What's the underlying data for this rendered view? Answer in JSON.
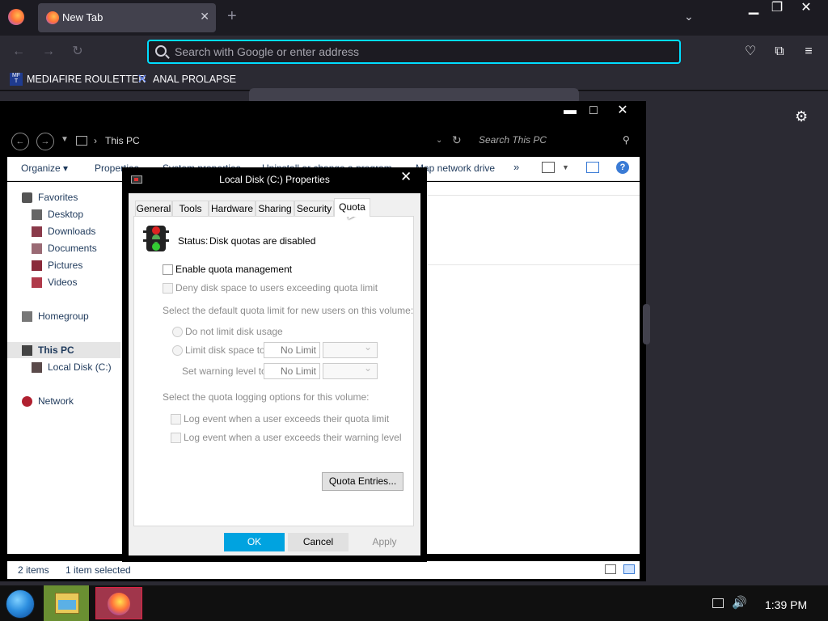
{
  "browser": {
    "tab_title": "New Tab",
    "url_placeholder": "Search with Google or enter address",
    "bookmarks": [
      {
        "label": "MEDIAFIRE ROULETTER",
        "icon_text": "MF T"
      },
      {
        "label": "ANAL PROLAPSE",
        "icon": "bookmark-x-icon"
      }
    ],
    "accent_color": "#00ddff"
  },
  "explorer": {
    "breadcrumb": "This PC",
    "search_placeholder": "Search This PC",
    "toolbar": {
      "organize": "Organize",
      "properties": "Properties",
      "system": "System properties",
      "uninstall": "Uninstall or change a program",
      "map_drive": "Map network drive",
      "more": "»"
    },
    "nav": {
      "favorites": "Favorites",
      "desktop": "Desktop",
      "downloads": "Downloads",
      "documents": "Documents",
      "pictures": "Pictures",
      "videos": "Videos",
      "homegroup": "Homegroup",
      "this_pc": "This PC",
      "local_disk": "Local Disk (C:)",
      "network": "Network"
    },
    "status": {
      "items": "2 items",
      "selected": "1 item selected"
    }
  },
  "dialog": {
    "title": "Local Disk (C:) Properties",
    "tabs": [
      "General",
      "Tools",
      "Hardware",
      "Sharing",
      "Security",
      "Quota"
    ],
    "active_tab": "Quota",
    "status_label": "Status:",
    "status_value": "Disk quotas are disabled",
    "enable_quota": "Enable quota management",
    "deny_space": "Deny disk space to users exceeding quota limit",
    "default_limit_heading": "Select the default quota limit for new users on this volume:",
    "no_limit_option": "Do not limit disk usage",
    "limit_to_option": "Limit disk space to",
    "limit_value": "No Limit",
    "warning_label": "Set warning level to",
    "warning_value": "No Limit",
    "logging_heading": "Select the quota logging options for this volume:",
    "log_quota": "Log event when a user exceeds their quota limit",
    "log_warning": "Log event when a user exceeds their warning level",
    "quota_entries_button": "Quota Entries...",
    "ok_button": "OK",
    "cancel_button": "Cancel",
    "apply_button": "Apply",
    "ok_color": "#00a3e0"
  },
  "taskbar": {
    "clock": "1:39 PM"
  }
}
